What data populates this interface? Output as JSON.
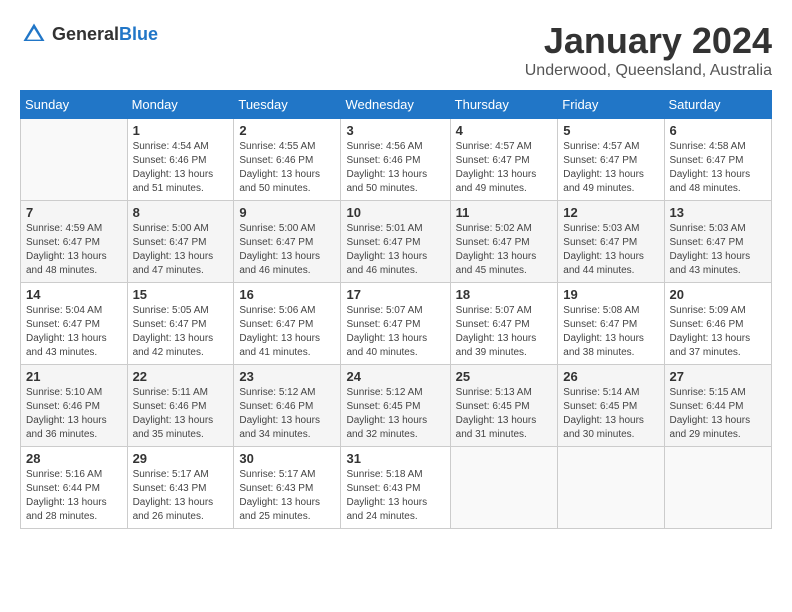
{
  "header": {
    "logo_general": "General",
    "logo_blue": "Blue",
    "title": "January 2024",
    "subtitle": "Underwood, Queensland, Australia"
  },
  "days_of_week": [
    "Sunday",
    "Monday",
    "Tuesday",
    "Wednesday",
    "Thursday",
    "Friday",
    "Saturday"
  ],
  "weeks": [
    [
      {
        "day": "",
        "sunrise": "",
        "sunset": "",
        "daylight": ""
      },
      {
        "day": "1",
        "sunrise": "Sunrise: 4:54 AM",
        "sunset": "Sunset: 6:46 PM",
        "daylight": "Daylight: 13 hours and 51 minutes."
      },
      {
        "day": "2",
        "sunrise": "Sunrise: 4:55 AM",
        "sunset": "Sunset: 6:46 PM",
        "daylight": "Daylight: 13 hours and 50 minutes."
      },
      {
        "day": "3",
        "sunrise": "Sunrise: 4:56 AM",
        "sunset": "Sunset: 6:46 PM",
        "daylight": "Daylight: 13 hours and 50 minutes."
      },
      {
        "day": "4",
        "sunrise": "Sunrise: 4:57 AM",
        "sunset": "Sunset: 6:47 PM",
        "daylight": "Daylight: 13 hours and 49 minutes."
      },
      {
        "day": "5",
        "sunrise": "Sunrise: 4:57 AM",
        "sunset": "Sunset: 6:47 PM",
        "daylight": "Daylight: 13 hours and 49 minutes."
      },
      {
        "day": "6",
        "sunrise": "Sunrise: 4:58 AM",
        "sunset": "Sunset: 6:47 PM",
        "daylight": "Daylight: 13 hours and 48 minutes."
      }
    ],
    [
      {
        "day": "7",
        "sunrise": "Sunrise: 4:59 AM",
        "sunset": "Sunset: 6:47 PM",
        "daylight": "Daylight: 13 hours and 48 minutes."
      },
      {
        "day": "8",
        "sunrise": "Sunrise: 5:00 AM",
        "sunset": "Sunset: 6:47 PM",
        "daylight": "Daylight: 13 hours and 47 minutes."
      },
      {
        "day": "9",
        "sunrise": "Sunrise: 5:00 AM",
        "sunset": "Sunset: 6:47 PM",
        "daylight": "Daylight: 13 hours and 46 minutes."
      },
      {
        "day": "10",
        "sunrise": "Sunrise: 5:01 AM",
        "sunset": "Sunset: 6:47 PM",
        "daylight": "Daylight: 13 hours and 46 minutes."
      },
      {
        "day": "11",
        "sunrise": "Sunrise: 5:02 AM",
        "sunset": "Sunset: 6:47 PM",
        "daylight": "Daylight: 13 hours and 45 minutes."
      },
      {
        "day": "12",
        "sunrise": "Sunrise: 5:03 AM",
        "sunset": "Sunset: 6:47 PM",
        "daylight": "Daylight: 13 hours and 44 minutes."
      },
      {
        "day": "13",
        "sunrise": "Sunrise: 5:03 AM",
        "sunset": "Sunset: 6:47 PM",
        "daylight": "Daylight: 13 hours and 43 minutes."
      }
    ],
    [
      {
        "day": "14",
        "sunrise": "Sunrise: 5:04 AM",
        "sunset": "Sunset: 6:47 PM",
        "daylight": "Daylight: 13 hours and 43 minutes."
      },
      {
        "day": "15",
        "sunrise": "Sunrise: 5:05 AM",
        "sunset": "Sunset: 6:47 PM",
        "daylight": "Daylight: 13 hours and 42 minutes."
      },
      {
        "day": "16",
        "sunrise": "Sunrise: 5:06 AM",
        "sunset": "Sunset: 6:47 PM",
        "daylight": "Daylight: 13 hours and 41 minutes."
      },
      {
        "day": "17",
        "sunrise": "Sunrise: 5:07 AM",
        "sunset": "Sunset: 6:47 PM",
        "daylight": "Daylight: 13 hours and 40 minutes."
      },
      {
        "day": "18",
        "sunrise": "Sunrise: 5:07 AM",
        "sunset": "Sunset: 6:47 PM",
        "daylight": "Daylight: 13 hours and 39 minutes."
      },
      {
        "day": "19",
        "sunrise": "Sunrise: 5:08 AM",
        "sunset": "Sunset: 6:47 PM",
        "daylight": "Daylight: 13 hours and 38 minutes."
      },
      {
        "day": "20",
        "sunrise": "Sunrise: 5:09 AM",
        "sunset": "Sunset: 6:46 PM",
        "daylight": "Daylight: 13 hours and 37 minutes."
      }
    ],
    [
      {
        "day": "21",
        "sunrise": "Sunrise: 5:10 AM",
        "sunset": "Sunset: 6:46 PM",
        "daylight": "Daylight: 13 hours and 36 minutes."
      },
      {
        "day": "22",
        "sunrise": "Sunrise: 5:11 AM",
        "sunset": "Sunset: 6:46 PM",
        "daylight": "Daylight: 13 hours and 35 minutes."
      },
      {
        "day": "23",
        "sunrise": "Sunrise: 5:12 AM",
        "sunset": "Sunset: 6:46 PM",
        "daylight": "Daylight: 13 hours and 34 minutes."
      },
      {
        "day": "24",
        "sunrise": "Sunrise: 5:12 AM",
        "sunset": "Sunset: 6:45 PM",
        "daylight": "Daylight: 13 hours and 32 minutes."
      },
      {
        "day": "25",
        "sunrise": "Sunrise: 5:13 AM",
        "sunset": "Sunset: 6:45 PM",
        "daylight": "Daylight: 13 hours and 31 minutes."
      },
      {
        "day": "26",
        "sunrise": "Sunrise: 5:14 AM",
        "sunset": "Sunset: 6:45 PM",
        "daylight": "Daylight: 13 hours and 30 minutes."
      },
      {
        "day": "27",
        "sunrise": "Sunrise: 5:15 AM",
        "sunset": "Sunset: 6:44 PM",
        "daylight": "Daylight: 13 hours and 29 minutes."
      }
    ],
    [
      {
        "day": "28",
        "sunrise": "Sunrise: 5:16 AM",
        "sunset": "Sunset: 6:44 PM",
        "daylight": "Daylight: 13 hours and 28 minutes."
      },
      {
        "day": "29",
        "sunrise": "Sunrise: 5:17 AM",
        "sunset": "Sunset: 6:43 PM",
        "daylight": "Daylight: 13 hours and 26 minutes."
      },
      {
        "day": "30",
        "sunrise": "Sunrise: 5:17 AM",
        "sunset": "Sunset: 6:43 PM",
        "daylight": "Daylight: 13 hours and 25 minutes."
      },
      {
        "day": "31",
        "sunrise": "Sunrise: 5:18 AM",
        "sunset": "Sunset: 6:43 PM",
        "daylight": "Daylight: 13 hours and 24 minutes."
      },
      {
        "day": "",
        "sunrise": "",
        "sunset": "",
        "daylight": ""
      },
      {
        "day": "",
        "sunrise": "",
        "sunset": "",
        "daylight": ""
      },
      {
        "day": "",
        "sunrise": "",
        "sunset": "",
        "daylight": ""
      }
    ]
  ]
}
